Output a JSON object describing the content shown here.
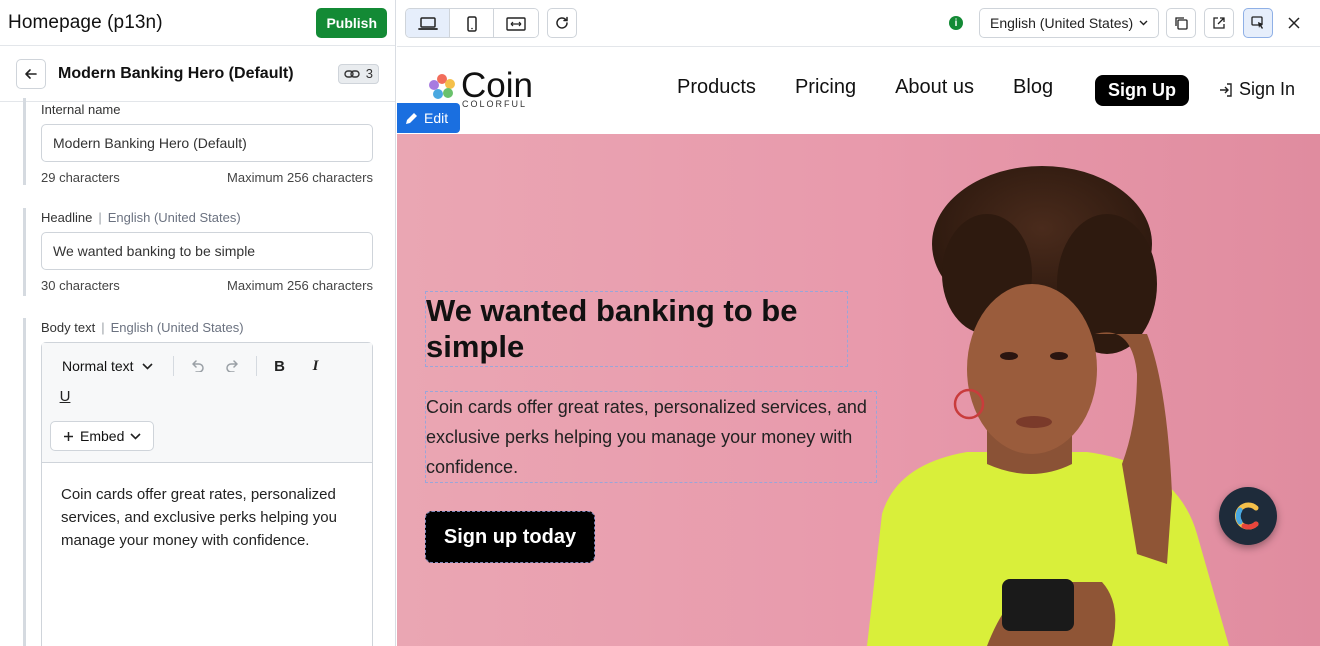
{
  "app": {
    "title": "Homepage (p13n)",
    "publish_label": "Publish"
  },
  "entry": {
    "title": "Modern Banking Hero (Default)",
    "reference_count": "3"
  },
  "fields": {
    "internal_name": {
      "label": "Internal name",
      "value": "Modern Banking Hero (Default)",
      "count": "29 characters",
      "max": "Maximum 256 characters"
    },
    "headline": {
      "label": "Headline",
      "separator": "|",
      "locale": "English (United States)",
      "value": "We wanted banking to be simple",
      "count": "30 characters",
      "max": "Maximum 256 characters"
    },
    "body": {
      "label": "Body text",
      "separator": "|",
      "locale": "English (United States)",
      "format_label": "Normal text",
      "bold": "B",
      "italic": "I",
      "underline": "U",
      "embed_label": "Embed",
      "value": "Coin cards offer great rates, personalized services, and exclusive perks helping you manage your money with confidence."
    }
  },
  "preview_toolbar": {
    "locale": "English (United States)",
    "info": "i",
    "active_device": "desktop"
  },
  "site": {
    "logo_word": "Coin",
    "logo_sub": "COLORFUL",
    "nav": [
      "Products",
      "Pricing",
      "About us",
      "Blog"
    ],
    "signup": "Sign Up",
    "signin": "Sign In",
    "edit_label": "Edit",
    "hero": {
      "headline": "We wanted banking to be simple",
      "body": "Coin cards offer great rates, personalized services, and exclusive perks helping you manage your money with confidence.",
      "cta": "Sign up today"
    }
  },
  "colors": {
    "publish": "#138a35",
    "accent_blue": "#1a6fe0",
    "hero_bg": "#e89aac",
    "shirt": "#d9ef3a"
  }
}
